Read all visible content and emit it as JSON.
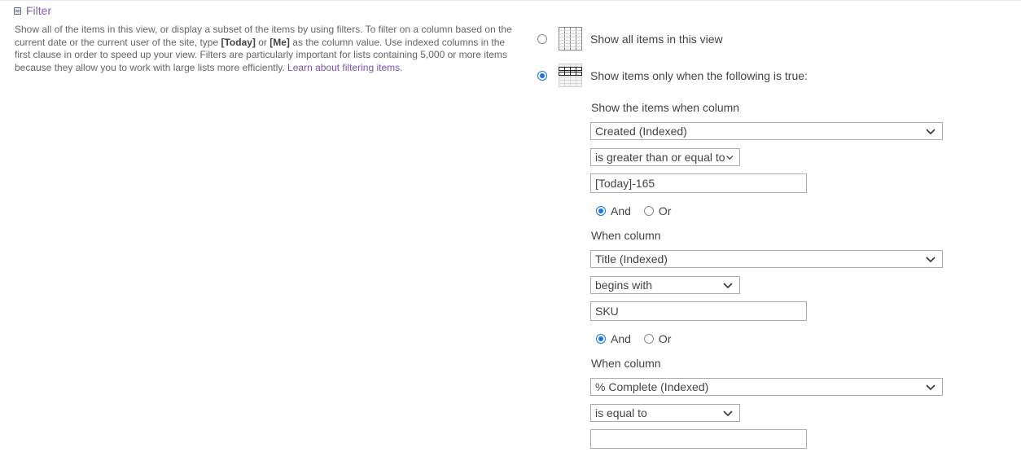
{
  "section": {
    "title": "Filter",
    "description_parts": {
      "p1": "Show all of the items in this view, or display a subset of the items by using filters. To filter on a column based on the current date or the current user of the site, type ",
      "today_token": "[Today]",
      "p2": " or ",
      "me_token": "[Me]",
      "p3": " as the column value. Use indexed columns in the first clause in order to speed up your view. Filters are particularly important for lists containing 5,000 or more items because they allow you to work with large lists more efficiently. ",
      "link": "Learn about filtering items."
    }
  },
  "options": {
    "show_all": {
      "label": "Show all items in this view",
      "selected": false
    },
    "show_filtered": {
      "label": "Show items only when the following is true:",
      "selected": true
    }
  },
  "clauses": [
    {
      "label": "Show the items when column",
      "column": "Created (Indexed)",
      "operator": "is greater than or equal to",
      "value": "[Today]-165",
      "conjunction": {
        "and_label": "And",
        "or_label": "Or",
        "selected": "And"
      }
    },
    {
      "label": "When column",
      "column": "Title (Indexed)",
      "operator": "begins with",
      "value": "SKU",
      "conjunction": {
        "and_label": "And",
        "or_label": "Or",
        "selected": "And"
      }
    },
    {
      "label": "When column",
      "column": "% Complete (Indexed)",
      "operator": "is equal to",
      "value": ""
    }
  ],
  "colors": {
    "accent_link": "#7a57b0",
    "radio_selected": "#1a73e8"
  }
}
